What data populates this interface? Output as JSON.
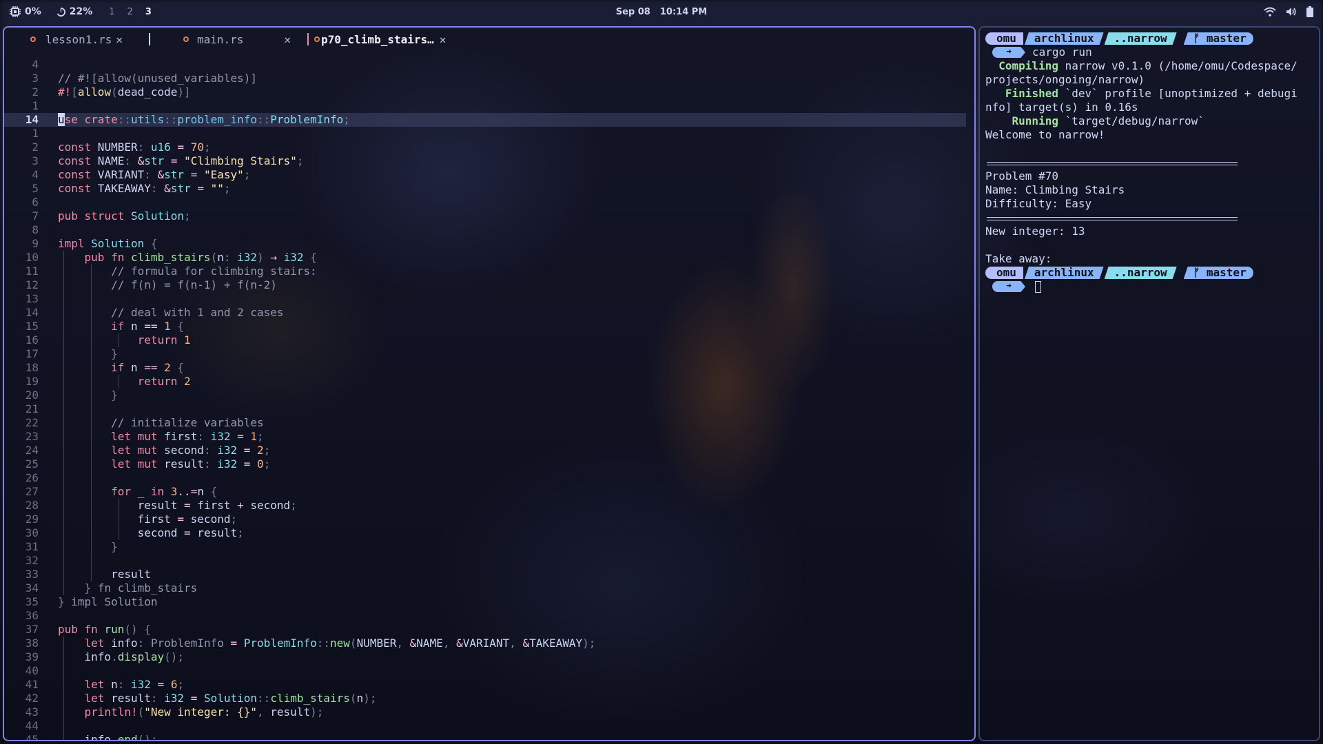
{
  "topbar": {
    "cpu_icon": "cpu-icon",
    "cpu": "0%",
    "mem_icon": "memory-icon",
    "mem": "22%",
    "workspaces": [
      "1",
      "2",
      "3"
    ],
    "active_workspace": "3",
    "date": "Sep 08",
    "time": "10:14 PM",
    "right_icons": [
      "wifi-icon",
      "volume-icon",
      "battery-icon"
    ]
  },
  "editor": {
    "tabs": [
      {
        "label": "lesson1.rs",
        "close": "✕"
      },
      {
        "label": "main.rs",
        "close": "✕"
      },
      {
        "label": "p70_climb_stairs…",
        "close": "✕"
      }
    ],
    "current_line_number": "14"
  },
  "terminal": {
    "prompt": {
      "user": "omu",
      "host": "archlinux",
      "dir": "..narrow",
      "branch": "ᚠ master"
    },
    "command": "cargo run",
    "output": {
      "compiling_label": "Compiling",
      "compiling_text": " narrow v0.1.0 (/home/omu/Codespace/",
      "compiling_cont": "projects/ongoing/narrow)",
      "finished_label": "Finished",
      "finished_text": " `dev` profile [unoptimized + debugi",
      "finished_cont": "nfo] target(s) in 0.16s",
      "running_label": "Running",
      "running_text": " `target/debug/narrow`",
      "welcome": "Welcome to narrow!",
      "problem": "Problem #70",
      "name": "Name: Climbing Stairs",
      "difficulty": "Difficulty: Easy",
      "new_integer": "New integer: 13",
      "take_away": "Take away:"
    }
  },
  "colors": {
    "accent_border": "#7f86e8",
    "keyword": "#f38ba8",
    "type": "#89dceb",
    "string": "#f9e2af",
    "number": "#fab387",
    "comment": "#9399b2",
    "success": "#a6e3a1",
    "prompt_blue": "#89b4fa"
  }
}
